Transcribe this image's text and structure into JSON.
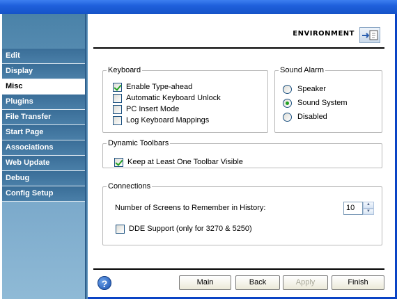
{
  "sidebar": {
    "items": [
      {
        "label": "Edit"
      },
      {
        "label": "Display"
      },
      {
        "label": "Misc"
      },
      {
        "label": "Plugins"
      },
      {
        "label": "File Transfer"
      },
      {
        "label": "Start Page"
      },
      {
        "label": "Associations"
      },
      {
        "label": "Web Update"
      },
      {
        "label": "Debug"
      },
      {
        "label": "Config Setup"
      }
    ],
    "active": "Misc"
  },
  "header": {
    "title": "ENVIRONMENT"
  },
  "keyboard": {
    "legend": "Keyboard",
    "options": [
      {
        "label": "Enable Type-ahead",
        "checked": true
      },
      {
        "label": "Automatic Keyboard Unlock",
        "checked": false
      },
      {
        "label": "PC Insert Mode",
        "checked": false
      },
      {
        "label": "Log Keyboard Mappings",
        "checked": false
      }
    ]
  },
  "sound_alarm": {
    "legend": "Sound Alarm",
    "options": [
      {
        "label": "Speaker",
        "selected": false
      },
      {
        "label": "Sound System",
        "selected": true
      },
      {
        "label": "Disabled",
        "selected": false
      }
    ]
  },
  "toolbars": {
    "legend": "Dynamic Toolbars",
    "keep_visible": {
      "label": "Keep at Least One Toolbar Visible",
      "checked": true
    }
  },
  "connections": {
    "legend": "Connections",
    "screens_label": "Number of Screens to Remember in History:",
    "screens_value": "10",
    "dde": {
      "label": "DDE Support (only for 3270 & 5250)",
      "checked": false
    }
  },
  "footer": {
    "help": "?",
    "main": "Main",
    "back": "Back",
    "apply": "Apply",
    "finish": "Finish"
  },
  "icons": {
    "help": "help-icon",
    "environment": "environment-icon",
    "check": "check-icon",
    "spinner_up": "spinner-up-icon",
    "spinner_down": "spinner-down-icon"
  }
}
